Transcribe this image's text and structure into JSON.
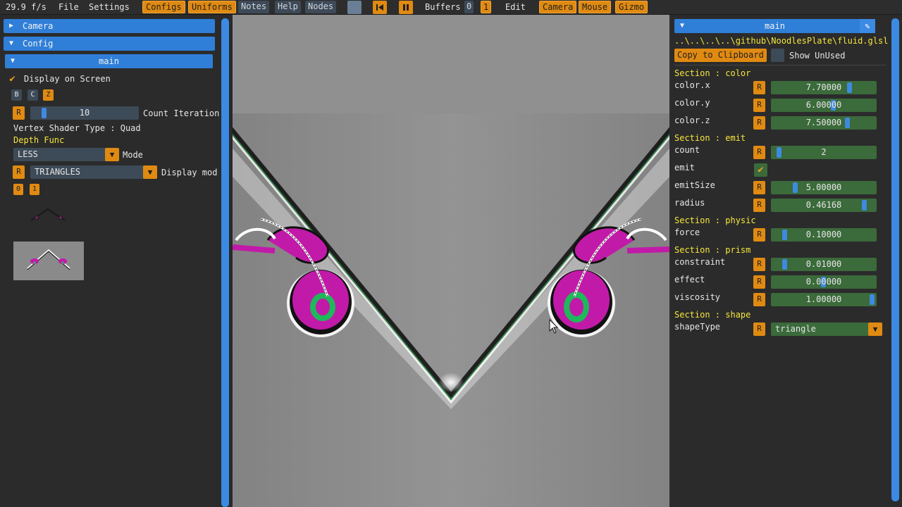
{
  "menubar": {
    "fps": "29.9 f/s",
    "file": "File",
    "settings": "Settings",
    "configs": "Configs",
    "uniforms": "Uniforms",
    "notes": "Notes",
    "help": "Help",
    "nodes": "Nodes",
    "buffers_label": "Buffers",
    "buffer0": "0",
    "buffer1": "1",
    "edit": "Edit",
    "camera": "Camera",
    "mouse": "Mouse",
    "gizmo": "Gizmo"
  },
  "left": {
    "camera_header": "Camera",
    "config_header": "Config",
    "main_header": "main",
    "display_on_screen": "Display on Screen",
    "btn_b": "B",
    "btn_c": "C",
    "btn_z": "Z",
    "reset": "R",
    "count_iteration_value": "10",
    "count_iteration_label": "Count Iteration",
    "vertex_shader_type": "Vertex Shader Type : Quad",
    "depth_func": "Depth Func",
    "depth_mode_value": "LESS",
    "mode_label": "Mode",
    "display_mode_value": "TRIANGLES",
    "display_mode_label": "Display mod",
    "buf0": "0",
    "buf1": "1"
  },
  "right": {
    "main_header": "main",
    "file_path": "..\\..\\..\\..\\github\\NoodlesPlate\\fluid.glsl",
    "copy_clipboard": "Copy to Clipboard",
    "show_unused": "Show UnUsed",
    "reset": "R",
    "sections": {
      "color": "Section : color",
      "emit": "Section : emit",
      "physic": "Section : physic",
      "prism": "Section : prism",
      "shape": "Section : shape"
    },
    "params": {
      "color_x": {
        "label": "color.x",
        "value": "7.70000"
      },
      "color_y": {
        "label": "color.y",
        "value": "6.00000"
      },
      "color_z": {
        "label": "color.z",
        "value": "7.50000"
      },
      "count": {
        "label": "count",
        "value": "2"
      },
      "emit": {
        "label": "emit"
      },
      "emit_size": {
        "label": "emitSize",
        "value": "5.00000"
      },
      "radius": {
        "label": "radius",
        "value": "0.46168"
      },
      "force": {
        "label": "force",
        "value": "0.10000"
      },
      "constraint": {
        "label": "constraint",
        "value": "0.01000"
      },
      "effect": {
        "label": "effect",
        "value": "0.00000"
      },
      "viscosity": {
        "label": "viscosity",
        "value": "1.00000"
      },
      "shape_type": {
        "label": "shapeType",
        "value": "triangle"
      }
    }
  },
  "colors": {
    "accent_orange": "#e08a12",
    "header_blue": "#2f7fd8",
    "section_yellow": "#f5e63c",
    "slider_green": "#3b6a3b",
    "fluid_magenta": "#c21aa8",
    "fluid_green": "#22c55e"
  }
}
